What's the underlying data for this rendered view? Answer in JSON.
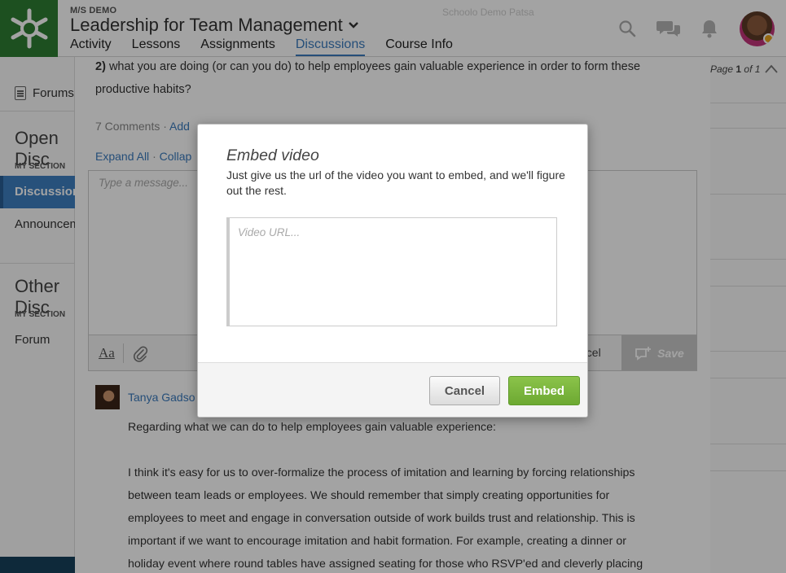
{
  "header": {
    "kicker": "M/S DEMO",
    "course_title": "Leadership for Team Management",
    "ghost_text": "Schoolo Demo Patsa",
    "tabs": [
      {
        "label": "Activity",
        "active": false
      },
      {
        "label": "Lessons",
        "active": false
      },
      {
        "label": "Assignments",
        "active": false
      },
      {
        "label": "Discussions",
        "active": true
      },
      {
        "label": "Course Info",
        "active": false
      }
    ],
    "icons": [
      "search-icon",
      "chat-icon",
      "bell-icon"
    ],
    "brand_color": "#2e7d32",
    "accent_color": "#3a7bbd"
  },
  "sidebar": {
    "forums_label": "Forums",
    "open_heading": "Open Disc",
    "open_section": "MY SECTION",
    "open_items": [
      "Discussion",
      "Announcem"
    ],
    "other_heading": "Other Disc",
    "other_section": "MY SECTION",
    "other_items": [
      "Forum"
    ]
  },
  "pager": {
    "prefix": "Page",
    "current": "1",
    "of": "of",
    "total": "1"
  },
  "thread": {
    "prompt_bold": "2)",
    "prompt_text": "what you are doing (or can you do) to help employees gain valuable experience in order to form these productive habits?",
    "comments": "7 Comments",
    "separator": "·",
    "add_link": "Add",
    "expand_all": "Expand All",
    "collapse": "Collap",
    "reply_placeholder": "Type a message...",
    "toolbar": {
      "format": "Aa",
      "cancel": "ncel",
      "save": "Save"
    },
    "post": {
      "author": "Tanya Gadso",
      "paragraph1": "Regarding what we can do to help employees gain valuable experience:",
      "paragraph2": "I think it's easy for us to over-formalize the process of imitation and learning by forcing relationships between team leads or employees. We should remember that simply creating opportunities for employees to meet and engage in conversation outside of work builds trust and relationship. This is important if we want to encourage imitation and habit formation. For example, creating a dinner or holiday event where round tables have assigned seating for those who RSVP'ed and cleverly placing"
    }
  },
  "modal": {
    "title": "Embed video",
    "description": "Just give us the url of the video you want to embed, and we'll figure out the rest.",
    "url_placeholder": "Video URL...",
    "url_value": "",
    "cancel_label": "Cancel",
    "embed_label": "Embed"
  }
}
